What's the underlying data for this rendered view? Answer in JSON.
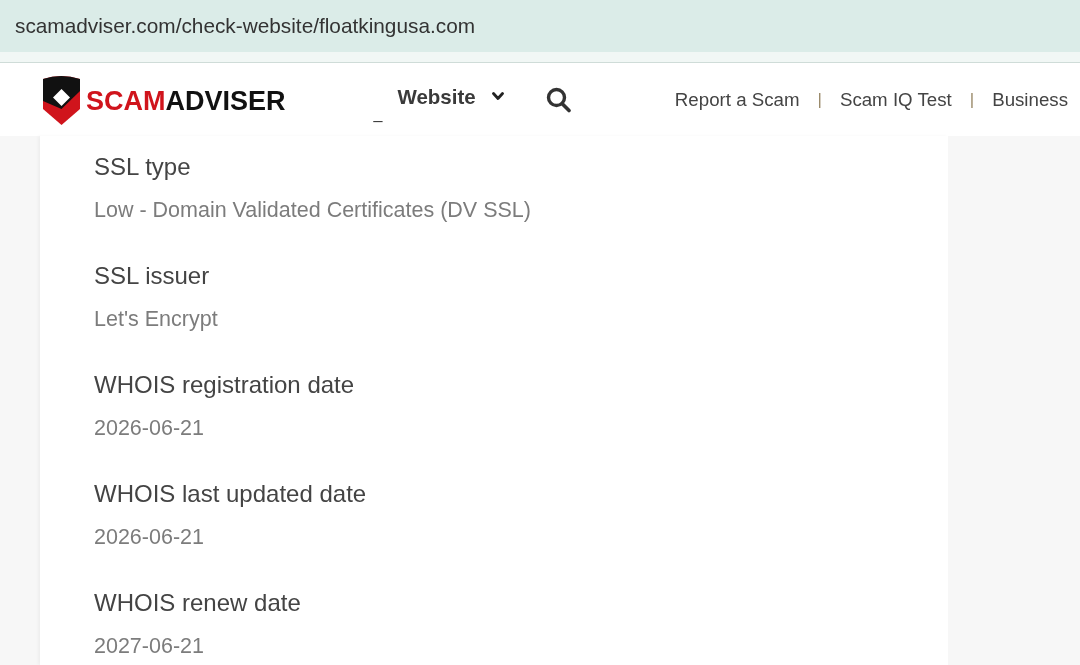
{
  "address_bar": {
    "url": "scamadviser.com/check-website/floatkingusa.com"
  },
  "header": {
    "logo": {
      "parts": [
        {
          "text": "SCAM",
          "color": "#d0141c"
        },
        {
          "text": "ADVISER",
          "color": "#111111"
        }
      ]
    },
    "underscore": "_",
    "menu": {
      "label": "Website"
    },
    "nav": [
      {
        "kind": "link",
        "text": "Report a Scam"
      },
      {
        "kind": "separator",
        "text": "|"
      },
      {
        "kind": "link",
        "text": "Scam IQ Test"
      },
      {
        "kind": "separator",
        "text": "|"
      },
      {
        "kind": "link",
        "text": "Business"
      }
    ]
  },
  "details": [
    {
      "label": "SSL type",
      "value": "Low - Domain Validated Certificates (DV SSL)"
    },
    {
      "label": "SSL issuer",
      "value": "Let's Encrypt"
    },
    {
      "label": "WHOIS registration date",
      "value": "2026-06-21"
    },
    {
      "label": "WHOIS last updated date",
      "value": "2026-06-21"
    },
    {
      "label": "WHOIS renew date",
      "value": "2027-06-21"
    }
  ]
}
